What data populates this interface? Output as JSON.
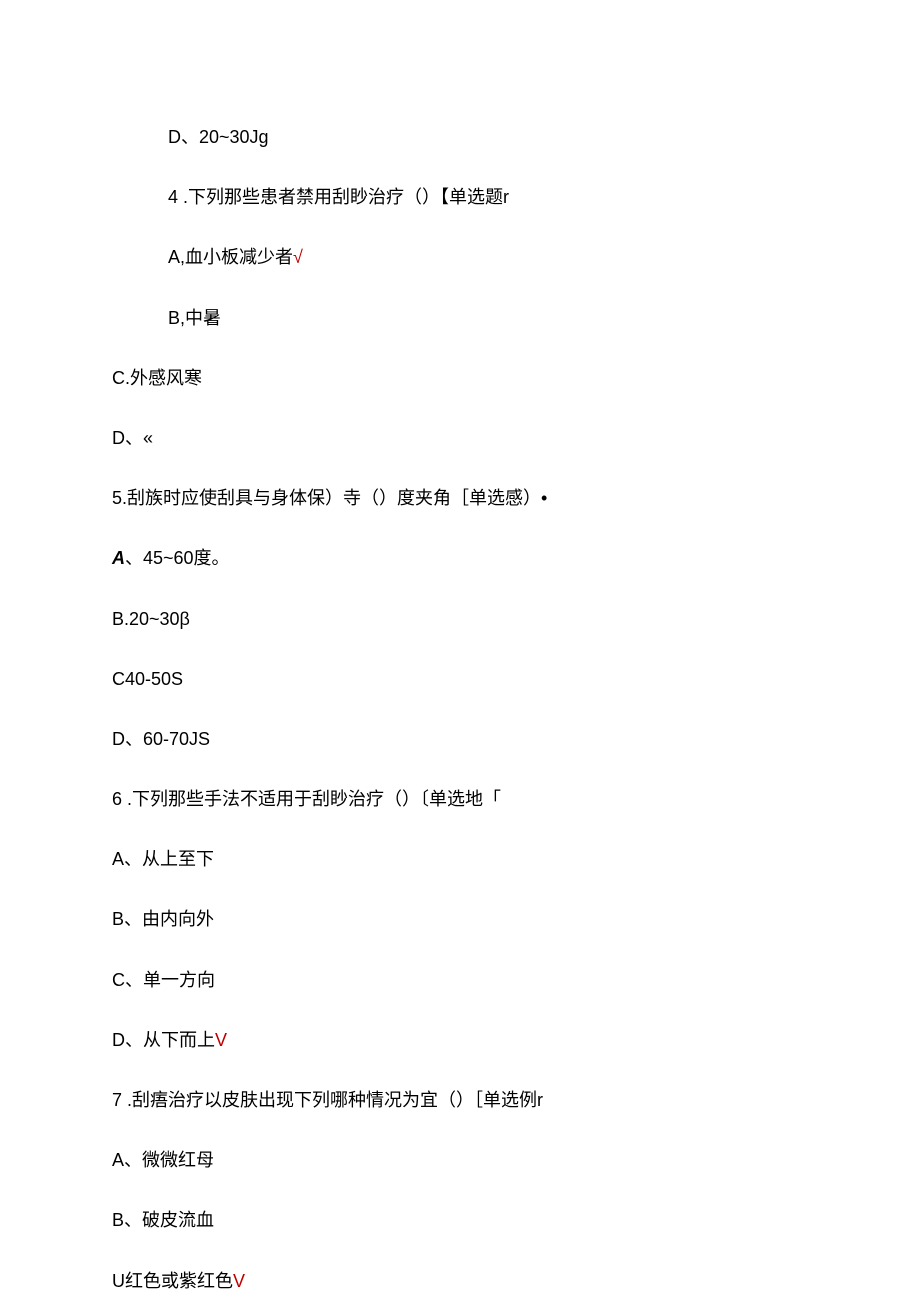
{
  "lines": [
    {
      "text": "D、20~30Jg",
      "indent": true
    },
    {
      "text_parts": [
        {
          "t": "4   .下列那些患者禁用刮眇治疗（）【单选题r"
        }
      ],
      "indent": true
    },
    {
      "text_parts": [
        {
          "t": "A,血小板减少者"
        },
        {
          "t": "√",
          "red": true
        }
      ],
      "indent": true
    },
    {
      "text": "B,中暑",
      "indent": true
    },
    {
      "text": "C.外感风寒"
    },
    {
      "text": "D、«"
    },
    {
      "text": "5.刮族时应使刮具与身体保）寺（）度夹角［单选感）•"
    },
    {
      "text_parts": [
        {
          "t": "A",
          "bi": true
        },
        {
          "t": "、45~60度。"
        }
      ]
    },
    {
      "text": "B.20~30β"
    },
    {
      "text": "C40-50S"
    },
    {
      "text": "D、60-70JS"
    },
    {
      "text": "6   .下列那些手法不适用于刮眇治疗（）〔单选地「"
    },
    {
      "text": "A、从上至下"
    },
    {
      "text": "B、由内向外"
    },
    {
      "text": "C、单一方向"
    },
    {
      "text_parts": [
        {
          "t": "D、从下而上"
        },
        {
          "t": "V",
          "red": true
        }
      ]
    },
    {
      "text": "7   .刮痦治疗以皮肤出现下列哪种情况为宜（）［单选例r"
    },
    {
      "text": "A、微微红母"
    },
    {
      "text": "B、破皮流血"
    },
    {
      "text_parts": [
        {
          "t": "U红色或紫红色"
        },
        {
          "t": "V",
          "red": true
        }
      ]
    }
  ]
}
